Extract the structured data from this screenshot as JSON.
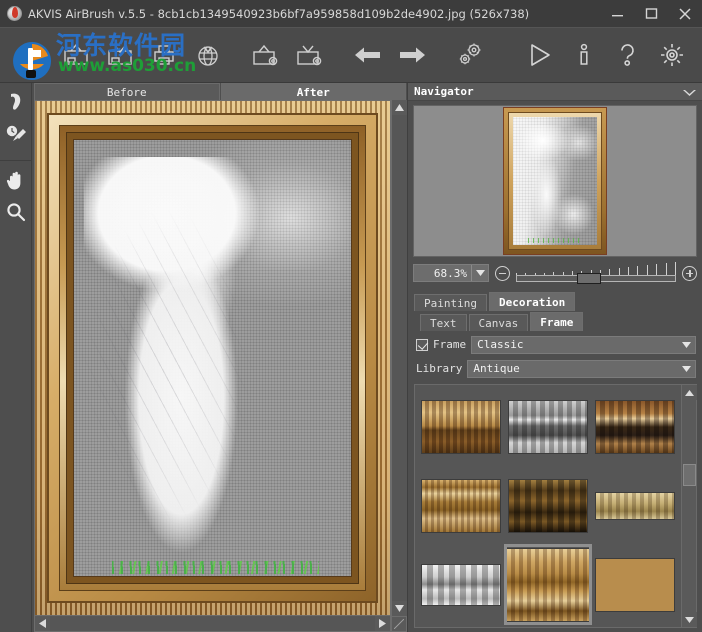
{
  "window": {
    "title": "AKVIS AirBrush v.5.5 - 8cb1cb1349540923b6bf7a959858d109b2de4902.jpg (526x738)",
    "logo_icon": "akvis-logo-icon",
    "minimize_label": "minimize",
    "maximize_label": "maximize",
    "close_label": "close"
  },
  "watermark": {
    "site_name": "河东软件园",
    "url": "www.as030.cn"
  },
  "toolbar": {
    "items": [
      {
        "icon": "open-image-icon",
        "label": "Open Image"
      },
      {
        "icon": "save-image-icon",
        "label": "Save Image"
      },
      {
        "icon": "print-image-icon",
        "label": "Print Image"
      },
      {
        "icon": "publish-icon",
        "label": "Publish"
      },
      {
        "icon": "load-preset-icon",
        "label": "Load Preset"
      },
      {
        "icon": "save-preset-icon",
        "label": "Save Preset"
      },
      {
        "icon": "undo-arrow-icon",
        "label": "Undo"
      },
      {
        "icon": "redo-arrow-icon",
        "label": "Redo"
      },
      {
        "icon": "gears-icon",
        "label": "Batch Processing"
      }
    ],
    "right_items": [
      {
        "icon": "run-play-icon",
        "label": "Run"
      },
      {
        "icon": "info-icon",
        "label": "About"
      },
      {
        "icon": "help-question-icon",
        "label": "Help"
      },
      {
        "icon": "preferences-gear-icon",
        "label": "Preferences"
      }
    ]
  },
  "tools": [
    {
      "icon": "smudge-brush-icon",
      "label": "History Brush"
    },
    {
      "icon": "history-brush-icon",
      "label": "Quick Brush"
    },
    {
      "icon": "hand-tool-icon",
      "label": "Hand"
    },
    {
      "icon": "zoom-magnifier-icon",
      "label": "Zoom"
    }
  ],
  "image_view": {
    "tabs": [
      {
        "label": "Before",
        "active": false
      },
      {
        "label": "After",
        "active": true
      }
    ]
  },
  "navigator": {
    "title": "Navigator",
    "collapse_icon": "chevron-down-icon",
    "zoom_value": "68.3%",
    "zoom_dropdown_icon": "chevron-down-icon",
    "zoom_out_icon": "minus-circle-icon",
    "zoom_in_icon": "plus-circle-icon"
  },
  "settings": {
    "main_tabs": [
      {
        "label": "Painting",
        "active": false
      },
      {
        "label": "Decoration",
        "active": true
      }
    ],
    "sub_tabs": [
      {
        "label": "Text",
        "active": false
      },
      {
        "label": "Canvas",
        "active": false
      },
      {
        "label": "Frame",
        "active": true
      }
    ],
    "frame_checkbox": {
      "label": "Frame",
      "checked": true
    },
    "frame_style": {
      "value": "Classic",
      "arrow_icon": "chevron-down-icon"
    },
    "library_label": "Library",
    "library_value": {
      "value": "Antique",
      "arrow_icon": "chevron-down-icon"
    }
  },
  "gallery": {
    "scroll_up_icon": "triangle-up-icon",
    "scroll_down_icon": "triangle-down-icon",
    "thumbnails": [
      {
        "id": "frame-1",
        "name": "gilt-scroll-light",
        "selected": false
      },
      {
        "id": "frame-2",
        "name": "silver-grey-carved",
        "selected": false
      },
      {
        "id": "frame-3",
        "name": "bronze-carved-dark",
        "selected": false
      },
      {
        "id": "frame-4",
        "name": "gold-rope-reeded",
        "selected": false
      },
      {
        "id": "frame-5",
        "name": "dark-acanthus-gilt",
        "selected": false
      },
      {
        "id": "frame-6",
        "name": "pale-vine-narrow",
        "selected": false
      },
      {
        "id": "frame-7",
        "name": "white-scroll-wave",
        "selected": false
      },
      {
        "id": "frame-8",
        "name": "classic-antique-gold",
        "selected": true
      },
      {
        "id": "frame-9",
        "name": "warm-acanthus-gold",
        "selected": false
      }
    ]
  },
  "scrollbars": {
    "v_up_icon": "triangle-up-icon",
    "v_down_icon": "triangle-down-icon",
    "h_left_icon": "triangle-left-icon",
    "h_right_icon": "triangle-right-icon",
    "resize_grip": "resize-grip-icon"
  },
  "colors": {
    "window_bg": "#4e4e4e",
    "titlebar_bg": "#3c3c3c",
    "toolbar_bg": "#4a4a4a",
    "tab_active": "#6b6b6b",
    "text": "#e2e2e2",
    "watermark_blue": "#2a6fc4",
    "watermark_green": "#1e9e37"
  }
}
